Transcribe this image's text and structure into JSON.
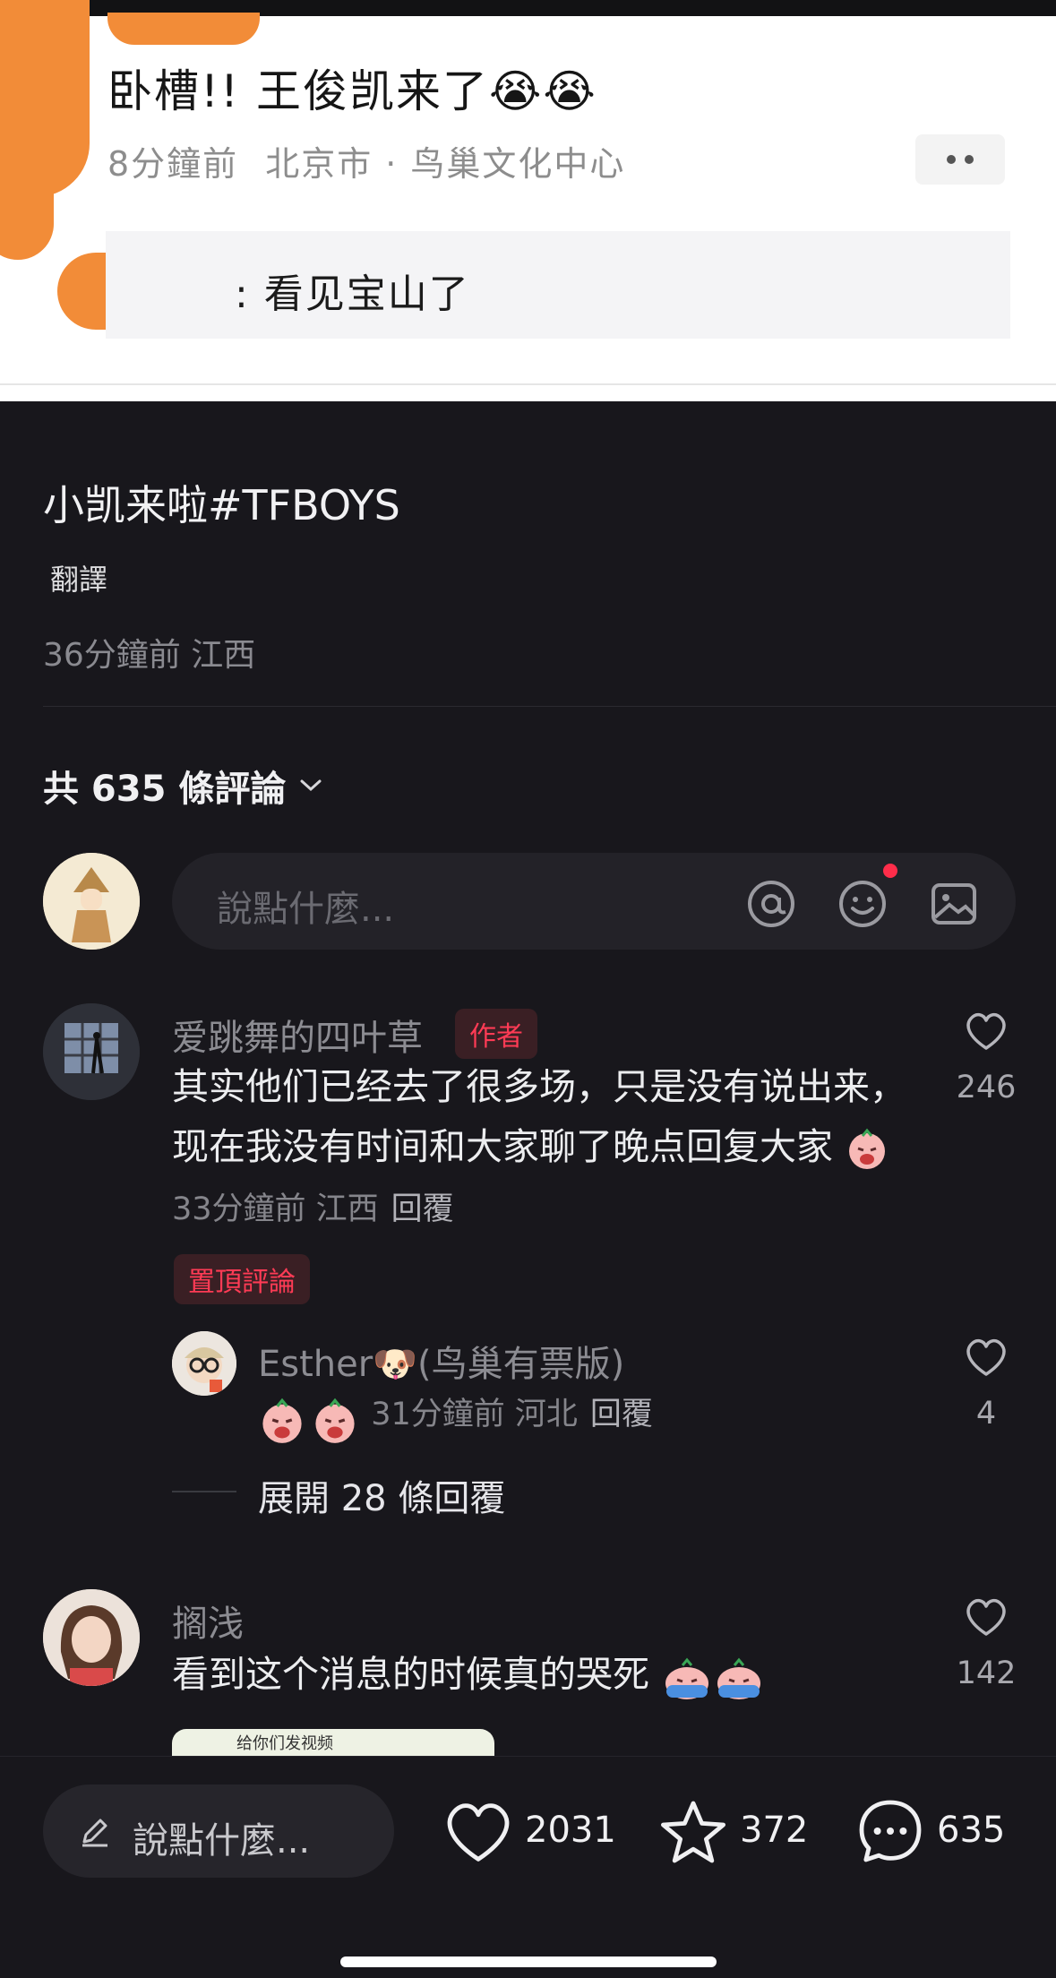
{
  "post": {
    "text": "卧槽!!  王俊凯来了😭😭",
    "time": "8分鐘前",
    "location": "北京市 · 鸟巢文化中心",
    "reply_text": ": 看见宝山了"
  },
  "caption": {
    "text": "小凯来啦#TFBOYS",
    "translate_label": "翻譯",
    "meta": "36分鐘前 江西"
  },
  "comments_header": {
    "count_label": "共 635 條評論"
  },
  "comment_input": {
    "placeholder": "說點什麼..."
  },
  "comments": [
    {
      "author": "爱跳舞的四叶草",
      "author_tag": "作者",
      "body": "其实他们已经去了很多场，只是没有说出来，现在我没有时间和大家聊了晚点回复大家",
      "meta": "33分鐘前 江西",
      "reply_label": "回覆",
      "likes": "246",
      "pinned_label": "置頂評論",
      "replies": [
        {
          "author": "Esther🐶(鸟巢有票版)",
          "meta": "31分鐘前 河北",
          "reply_label": "回覆",
          "likes": "4"
        }
      ],
      "expand_label": "展開 28 條回覆"
    },
    {
      "author": "搁浅",
      "body": "看到这个消息的时候真的哭死",
      "likes": "142",
      "media_label": "给你们发视频"
    }
  ],
  "bottom_bar": {
    "input_placeholder": "說點什麼...",
    "likes": "2031",
    "favorites": "372",
    "comments": "635"
  },
  "colors": {
    "background": "#18171c",
    "accent_red": "#ff3b55",
    "redaction_orange": "#f28c38"
  },
  "icons": [
    "pencil-icon",
    "heart-icon",
    "star-icon",
    "chat-bubble-icon",
    "at-icon",
    "smile-icon",
    "image-icon",
    "chevron-down-icon"
  ]
}
